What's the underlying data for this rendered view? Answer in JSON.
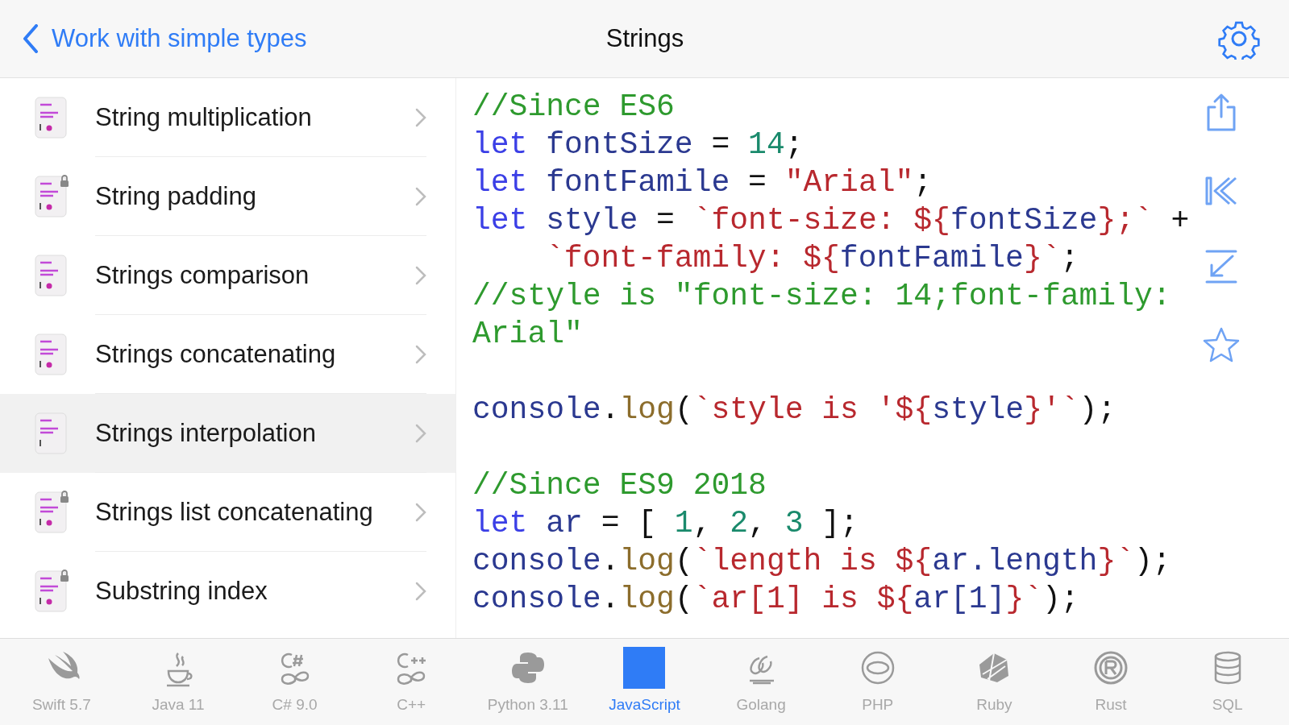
{
  "nav_bar": {
    "back_label": "Work with simple types",
    "title": "Strings"
  },
  "topics": [
    {
      "label": "String multiplication",
      "locked": false,
      "selected": false
    },
    {
      "label": "String padding",
      "locked": true,
      "selected": false
    },
    {
      "label": "Strings comparison",
      "locked": false,
      "selected": false
    },
    {
      "label": "Strings concatenating",
      "locked": false,
      "selected": false
    },
    {
      "label": "Strings interpolation",
      "locked": false,
      "selected": true
    },
    {
      "label": "Strings list concatenating",
      "locked": true,
      "selected": false
    },
    {
      "label": "Substring index",
      "locked": true,
      "selected": false
    }
  ],
  "code_lines": [
    {
      "kind": "code",
      "indented": false,
      "tokens": [
        {
          "kind": "comment",
          "text": "//Since ES6"
        }
      ]
    },
    {
      "kind": "code",
      "indented": false,
      "tokens": [
        {
          "kind": "keyword",
          "text": "let"
        },
        {
          "kind": "ident",
          "text": "fontSize",
          "space_before": true
        },
        {
          "kind": "plain",
          "text": " = "
        },
        {
          "kind": "number",
          "text": "14"
        },
        {
          "kind": "plain",
          "text": ";"
        }
      ]
    },
    {
      "kind": "code",
      "indented": false,
      "tokens": [
        {
          "kind": "keyword",
          "text": "let"
        },
        {
          "kind": "ident",
          "text": "fontFamile",
          "space_before": true
        },
        {
          "kind": "plain",
          "text": " = "
        },
        {
          "kind": "string",
          "text": "\"Arial\""
        },
        {
          "kind": "plain",
          "text": ";"
        }
      ]
    },
    {
      "kind": "code",
      "indented": false,
      "tokens": [
        {
          "kind": "keyword",
          "text": "let"
        },
        {
          "kind": "ident",
          "text": "style",
          "space_before": true
        },
        {
          "kind": "plain",
          "text": " = "
        },
        {
          "kind": "string",
          "text": "`font-size: ${"
        },
        {
          "kind": "ident",
          "text": "fontSize"
        },
        {
          "kind": "string",
          "text": "};`"
        },
        {
          "kind": "plain",
          "text": " +"
        }
      ]
    },
    {
      "kind": "code",
      "indented": true,
      "tokens": [
        {
          "kind": "string",
          "text": "`font-family: ${"
        },
        {
          "kind": "ident",
          "text": "fontFamile"
        },
        {
          "kind": "string",
          "text": "}`"
        },
        {
          "kind": "plain",
          "text": ";"
        }
      ]
    },
    {
      "kind": "code",
      "indented": false,
      "tokens": [
        {
          "kind": "comment",
          "text": "//style is \"font-size: 14;font-family:"
        }
      ]
    },
    {
      "kind": "code",
      "indented": false,
      "tokens": [
        {
          "kind": "comment",
          "text": "Arial\""
        }
      ]
    },
    {
      "kind": "blank"
    },
    {
      "kind": "code",
      "indented": false,
      "tokens": [
        {
          "kind": "ident",
          "text": "console"
        },
        {
          "kind": "plain",
          "text": "."
        },
        {
          "kind": "func",
          "text": "log"
        },
        {
          "kind": "plain",
          "text": "("
        },
        {
          "kind": "string",
          "text": "`style is '${"
        },
        {
          "kind": "ident",
          "text": "style"
        },
        {
          "kind": "string",
          "text": "}'`"
        },
        {
          "kind": "plain",
          "text": ");"
        }
      ]
    },
    {
      "kind": "blank"
    },
    {
      "kind": "code",
      "indented": false,
      "tokens": [
        {
          "kind": "comment",
          "text": "//Since ES9 2018"
        }
      ]
    },
    {
      "kind": "code",
      "indented": false,
      "tokens": [
        {
          "kind": "keyword",
          "text": "let"
        },
        {
          "kind": "ident",
          "text": "ar",
          "space_before": true
        },
        {
          "kind": "plain",
          "text": " = [ "
        },
        {
          "kind": "number",
          "text": "1"
        },
        {
          "kind": "plain",
          "text": ", "
        },
        {
          "kind": "number",
          "text": "2"
        },
        {
          "kind": "plain",
          "text": ", "
        },
        {
          "kind": "number",
          "text": "3"
        },
        {
          "kind": "plain",
          "text": " ];"
        }
      ]
    },
    {
      "kind": "code",
      "indented": false,
      "tokens": [
        {
          "kind": "ident",
          "text": "console"
        },
        {
          "kind": "plain",
          "text": "."
        },
        {
          "kind": "func",
          "text": "log"
        },
        {
          "kind": "plain",
          "text": "("
        },
        {
          "kind": "string",
          "text": "`length is ${"
        },
        {
          "kind": "ident",
          "text": "ar.length"
        },
        {
          "kind": "string",
          "text": "}`"
        },
        {
          "kind": "plain",
          "text": ");"
        }
      ]
    },
    {
      "kind": "code",
      "indented": false,
      "tokens": [
        {
          "kind": "ident",
          "text": "console"
        },
        {
          "kind": "plain",
          "text": "."
        },
        {
          "kind": "func",
          "text": "log"
        },
        {
          "kind": "plain",
          "text": "("
        },
        {
          "kind": "string",
          "text": "`ar[1] is ${"
        },
        {
          "kind": "ident",
          "text": "ar[1]"
        },
        {
          "kind": "string",
          "text": "}`"
        },
        {
          "kind": "plain",
          "text": ");"
        }
      ]
    }
  ],
  "languages": [
    {
      "label": "Swift 5.7",
      "selected": false
    },
    {
      "label": "Java 11",
      "selected": false
    },
    {
      "label": "C# 9.0",
      "selected": false
    },
    {
      "label": "C++",
      "selected": false
    },
    {
      "label": "Python 3.11",
      "selected": false
    },
    {
      "label": "JavaScript",
      "selected": true
    },
    {
      "label": "Golang",
      "selected": false
    },
    {
      "label": "PHP",
      "selected": false
    },
    {
      "label": "Ruby",
      "selected": false
    },
    {
      "label": "Rust",
      "selected": false
    },
    {
      "label": "SQL",
      "selected": false
    }
  ]
}
